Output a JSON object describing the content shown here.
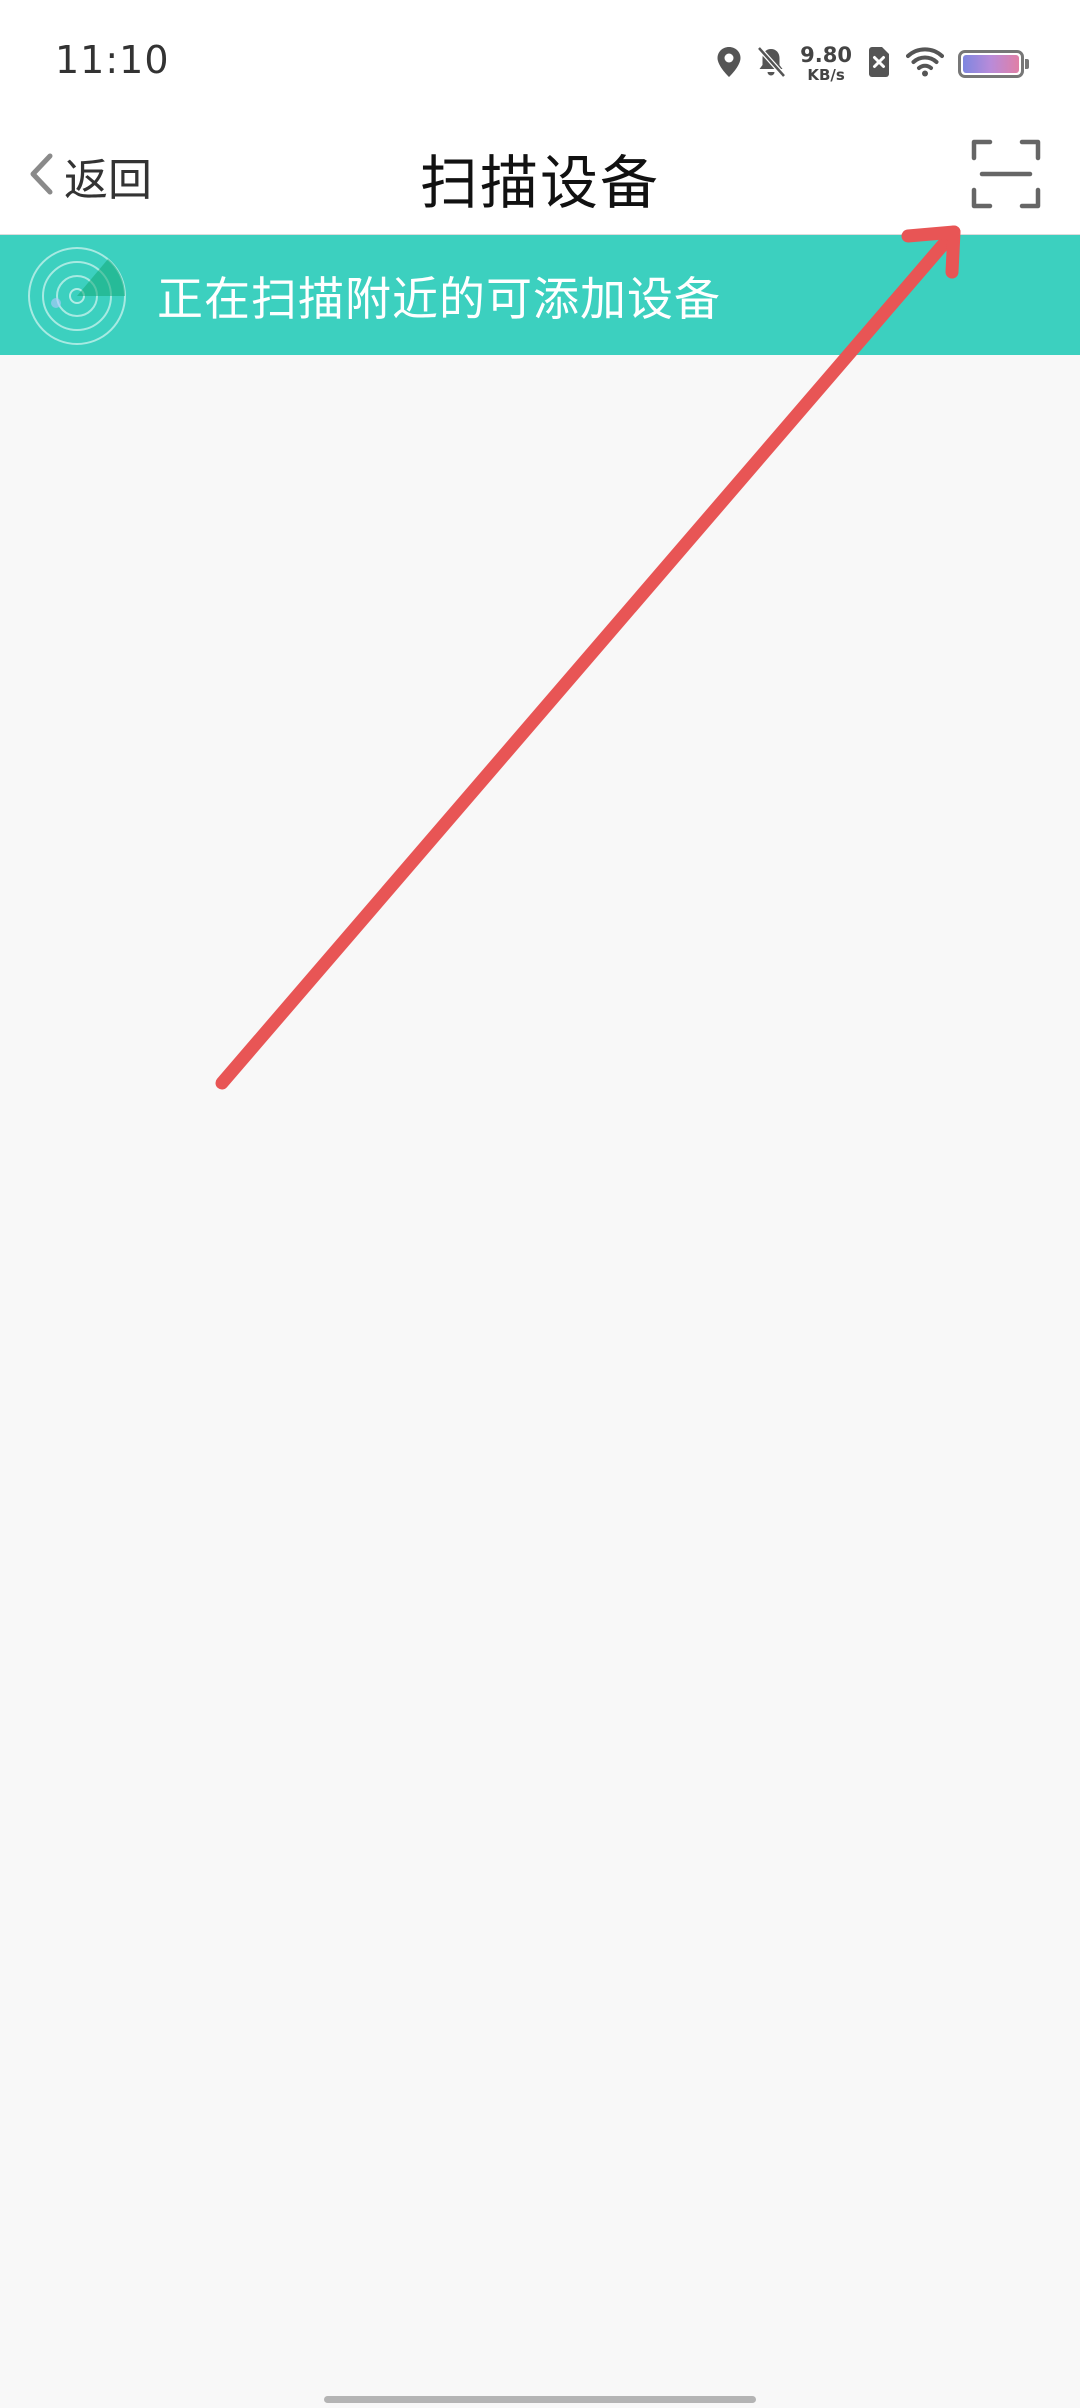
{
  "status_bar": {
    "time": "11:10",
    "net_speed_value": "9.80",
    "net_speed_unit": "KB/s",
    "icons": [
      "location-icon",
      "bell-muted-icon",
      "sim-error-icon",
      "wifi-icon",
      "battery-icon"
    ]
  },
  "header": {
    "back_label": "返回",
    "title": "扫描设备",
    "scan_icon": "scan-frame-icon"
  },
  "banner": {
    "text": "正在扫描附近的可添加设备",
    "icon": "radar-icon",
    "color": "#3cd0bf"
  },
  "annotation": {
    "type": "arrow",
    "color": "#e85555",
    "target": "scan-button"
  }
}
